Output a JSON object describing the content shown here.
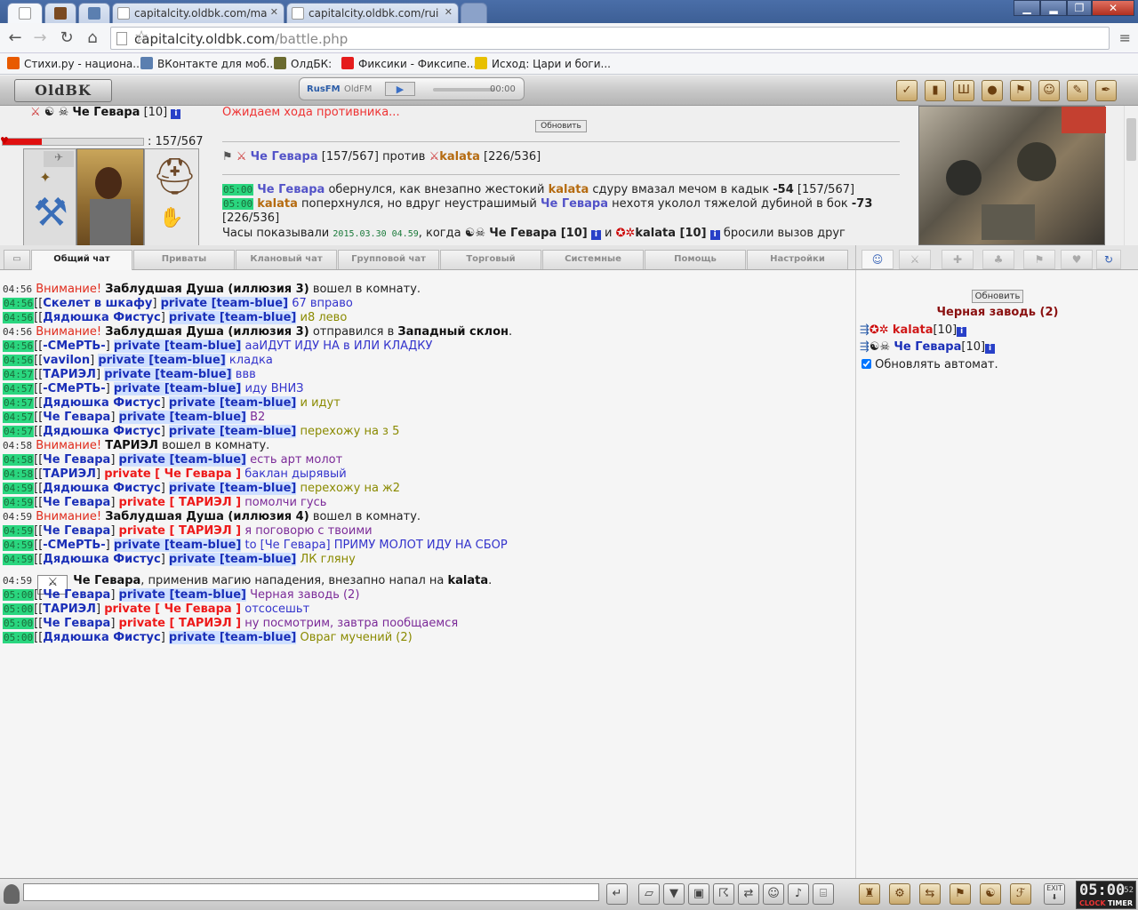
{
  "browser": {
    "tabs": [
      {
        "label": "",
        "icon": "new-tab-page"
      },
      {
        "label": "",
        "icon": "game-portrait"
      },
      {
        "label": "",
        "icon": "vk"
      },
      {
        "label": "capitalcity.oldbk.com/ma"
      },
      {
        "label": "capitalcity.oldbk.com/rui"
      }
    ],
    "url_host": "capitalcity.oldbk.com",
    "url_path": "/battle.php",
    "bookmarks": [
      {
        "label": "Стихи.ру - национа...",
        "color": "#e85a00"
      },
      {
        "label": "ВКонтакте для моб...",
        "color": "#5b7fb0"
      },
      {
        "label": "ОлдБК:",
        "color": "#6b6b30"
      },
      {
        "label": "Фиксики - Фиксипе...",
        "color": "#e51c1c"
      },
      {
        "label": "Исход: Цари и боги...",
        "color": "#e8c000"
      }
    ]
  },
  "game": {
    "logo": "OldBK",
    "radio": {
      "brand": "RusFM",
      "brand2": "OldFM",
      "time": "00:00"
    },
    "top_icons": [
      "ok",
      "stats",
      "bank",
      "gold",
      "quest",
      "user",
      "book",
      "quill"
    ]
  },
  "battle": {
    "player": {
      "name": "Че Гевара",
      "level": "[10]",
      "hp_text": ": 157/567",
      "hp_fraction": 0.277
    },
    "waiting": "Ожидаем хода противника...",
    "refresh": "Обновить",
    "versus": {
      "p1": "Че Гевара",
      "p1_hp": "[157/567]",
      "word": "против",
      "p2": "kalata",
      "p2_hp": "[226/536]"
    },
    "log": [
      {
        "time": "05:00",
        "a": "Че Гевара",
        "t1": "обернулся, как внезапно жестокий",
        "b": "kalata",
        "t2": "сдуру вмазал мечом в кадык",
        "dmg": "-54",
        "hp": "[157/567]"
      },
      {
        "time": "05:00",
        "a": "kalata",
        "t1": "поперхнулся, но вдруг неустрашимый",
        "b": "Че Гевара",
        "t2": "нехотя уколол тяжелой дубиной в бок",
        "dmg": "-73",
        "hp": "[226/536]"
      }
    ],
    "clock_line": {
      "t1": "Часы показывали",
      "date": "2015.03.30 04.59",
      "t2": ", когда",
      "p1": "Че Гевара [10]",
      "and": "и",
      "p2": "kalata [10]",
      "t3": "бросили вызов друг"
    }
  },
  "chat_tabs": [
    "Общий чат",
    "Приваты",
    "Клановый чат",
    "Групповой чат",
    "Торговый",
    "Системные",
    "Помощь",
    "Настройки"
  ],
  "chat": [
    {
      "time": "04:56",
      "hl": false,
      "kind": "warn",
      "warn": "Внимание!",
      "name": "Заблудшая Душа (иллюзия 3)",
      "text": "вошел в комнату."
    },
    {
      "time": "04:56",
      "hl": true,
      "kind": "msg",
      "nick": "Скелет в шкафу",
      "priv": "private [team-blue]",
      "privcolor": "blue",
      "text": "67 вправо",
      "tc": "blue"
    },
    {
      "time": "04:56",
      "hl": true,
      "kind": "msg",
      "nick": "Дядюшка Фистус",
      "priv": "private [team-blue]",
      "privcolor": "blue",
      "text": "и8 лево",
      "tc": "olive"
    },
    {
      "time": "04:56",
      "hl": false,
      "kind": "warn",
      "warn": "Внимание!",
      "name": "Заблудшая Душа (иллюзия 3)",
      "text": "отправился в",
      "place": "Западный склон",
      "end": "."
    },
    {
      "time": "04:56",
      "hl": true,
      "kind": "msg",
      "nick": "-СМеРТЬ-",
      "priv": "private [team-blue]",
      "privcolor": "blue",
      "text": "ааИДУТ ИДУ НА в ИЛИ КЛАДКУ",
      "tc": "blue"
    },
    {
      "time": "04:56",
      "hl": true,
      "kind": "msg",
      "nick": "vavilon",
      "priv": "private [team-blue]",
      "privcolor": "blue",
      "text": "кладка",
      "tc": "blue"
    },
    {
      "time": "04:57",
      "hl": true,
      "kind": "msg",
      "nick": "ТАРИЭЛ",
      "priv": "private [team-blue]",
      "privcolor": "blue",
      "text": "ввв",
      "tc": "blue"
    },
    {
      "time": "04:57",
      "hl": true,
      "kind": "msg",
      "nick": "-СМеРТЬ-",
      "priv": "private [team-blue]",
      "privcolor": "blue",
      "text": "иду ВНИЗ",
      "tc": "blue"
    },
    {
      "time": "04:57",
      "hl": true,
      "kind": "msg",
      "nick": "Дядюшка Фистус",
      "priv": "private [team-blue]",
      "privcolor": "blue",
      "text": "и идут",
      "tc": "olive"
    },
    {
      "time": "04:57",
      "hl": true,
      "kind": "msg",
      "nick": "Че Гевара",
      "priv": "private [team-blue]",
      "privcolor": "blue",
      "text": "В2",
      "tc": "purple"
    },
    {
      "time": "04:57",
      "hl": true,
      "kind": "msg",
      "nick": "Дядюшка Фистус",
      "priv": "private [team-blue]",
      "privcolor": "blue",
      "text": "перехожу на з 5",
      "tc": "olive"
    },
    {
      "time": "04:58",
      "hl": false,
      "kind": "warn",
      "warn": "Внимание!",
      "name": "ТАРИЭЛ",
      "text": "вошел в комнату."
    },
    {
      "time": "04:58",
      "hl": true,
      "kind": "msg",
      "nick": "Че Гевара",
      "priv": "private [team-blue]",
      "privcolor": "blue",
      "text": "есть арт молот",
      "tc": "purple"
    },
    {
      "time": "04:58",
      "hl": true,
      "kind": "msg",
      "nick": "ТАРИЭЛ",
      "priv": "private [ Че Гевара ]",
      "privcolor": "red",
      "text": "баклан дырявый",
      "tc": "blue"
    },
    {
      "time": "04:59",
      "hl": true,
      "kind": "msg",
      "nick": "Дядюшка Фистус",
      "priv": "private [team-blue]",
      "privcolor": "blue",
      "text": "перехожу на ж2",
      "tc": "olive"
    },
    {
      "time": "04:59",
      "hl": true,
      "kind": "msg",
      "nick": "Че Гевара",
      "priv": "private [ ТАРИЭЛ ]",
      "privcolor": "red",
      "text": "помолчи гусь",
      "tc": "purple"
    },
    {
      "time": "04:59",
      "hl": false,
      "kind": "warn",
      "warn": "Внимание!",
      "name": "Заблудшая Душа (иллюзия 4)",
      "text": "вошел в комнату."
    },
    {
      "time": "04:59",
      "hl": true,
      "kind": "msg",
      "nick": "Че Гевара",
      "priv": "private [ ТАРИЭЛ ]",
      "privcolor": "red",
      "text": "я поговорю с твоими",
      "tc": "purple"
    },
    {
      "time": "04:59",
      "hl": true,
      "kind": "msg",
      "nick": "-СМеРТЬ-",
      "priv": "private [team-blue]",
      "privcolor": "blue",
      "text": "to [Че Гевара] ПРИМУ МОЛОТ ИДУ НА СБОР",
      "tc": "blue"
    },
    {
      "time": "04:59",
      "hl": true,
      "kind": "msg",
      "nick": "Дядюшка Фистус",
      "priv": "private [team-blue]",
      "privcolor": "blue",
      "text": "ЛК гляну",
      "tc": "olive"
    },
    {
      "time": "04:59",
      "hl": false,
      "kind": "attack",
      "name": "Че Гевара",
      "text": ", применив магию нападения, внезапно напал на",
      "target": "kalata",
      "end": "."
    },
    {
      "time": "05:00",
      "hl": true,
      "kind": "msg",
      "nick": "Че Гевара",
      "priv": "private [team-blue]",
      "privcolor": "blue",
      "text": "Черная заводь (2)",
      "tc": "purple"
    },
    {
      "time": "05:00",
      "hl": true,
      "kind": "msg",
      "nick": "ТАРИЭЛ",
      "priv": "private [ Че Гевара ]",
      "privcolor": "red",
      "text": "отсосешьт",
      "tc": "blue"
    },
    {
      "time": "05:00",
      "hl": true,
      "kind": "msg",
      "nick": "Че Гевара",
      "priv": "private [ ТАРИЭЛ ]",
      "privcolor": "red",
      "text": "ну посмотрим, завтра пообщаемся",
      "tc": "purple"
    },
    {
      "time": "05:00",
      "hl": true,
      "kind": "msg",
      "nick": "Дядюшка Фистус",
      "priv": "private [team-blue]",
      "privcolor": "blue",
      "text": "Овраг мучений (2)",
      "tc": "olive"
    }
  ],
  "online": {
    "refresh": "Обновить",
    "room": "Черная заводь (2)",
    "players": [
      {
        "name": "kalata",
        "level": "[10]",
        "color": "#d01818"
      },
      {
        "name": "Че Гевара",
        "level": "[10]",
        "color": "#1a2fb8"
      }
    ],
    "auto": "Обновлять автомат."
  },
  "clock": {
    "time": "05:00",
    "sec": "52",
    "label1": "CLOCK",
    "label2": "TIMER"
  },
  "colors": {
    "timestamp_bg": "#2ad67f",
    "warn": "#e02a1a",
    "nick": "#1a2fb8",
    "private_red": "#ee1a1a"
  }
}
